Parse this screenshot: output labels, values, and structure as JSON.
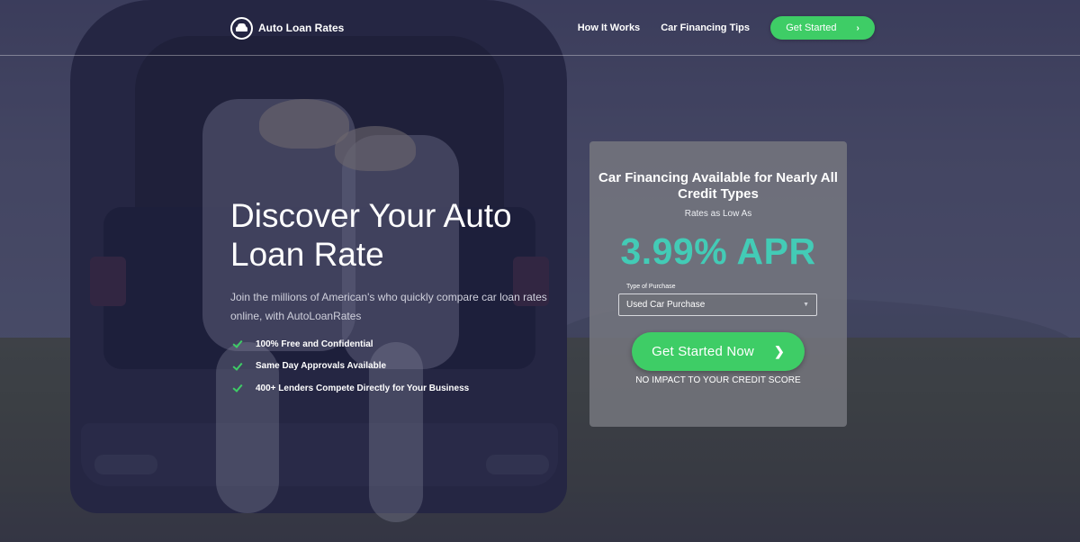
{
  "header": {
    "logo_text": "Auto Loan Rates",
    "nav_links": [
      "How It Works",
      "Car Financing Tips"
    ],
    "cta_label": "Get Started"
  },
  "hero": {
    "title": "Discover Your Auto Loan Rate",
    "subtitle": "Join the millions of American's who quickly compare car loan rates online, with AutoLoanRates",
    "features": [
      "100% Free and Confidential",
      "Same Day Approvals Available",
      "400+ Lenders Compete Directly for Your Business"
    ]
  },
  "card": {
    "title": "Car Financing Available for Nearly All Credit Types",
    "subtitle": "Rates as Low As",
    "rate": "3.99% APR",
    "select_label": "Type of Purchase",
    "select_value": "Used Car Purchase",
    "cta_label": "Get Started Now",
    "note": "NO IMPACT TO YOUR CREDIT SCORE"
  },
  "icons": {
    "logo": "car-circle-icon",
    "chevron": "chevron-right-icon",
    "check": "check-icon",
    "caret": "caret-down-icon"
  },
  "colors": {
    "accent_green": "#3ecd66",
    "rate_teal": "#43cbb6"
  }
}
